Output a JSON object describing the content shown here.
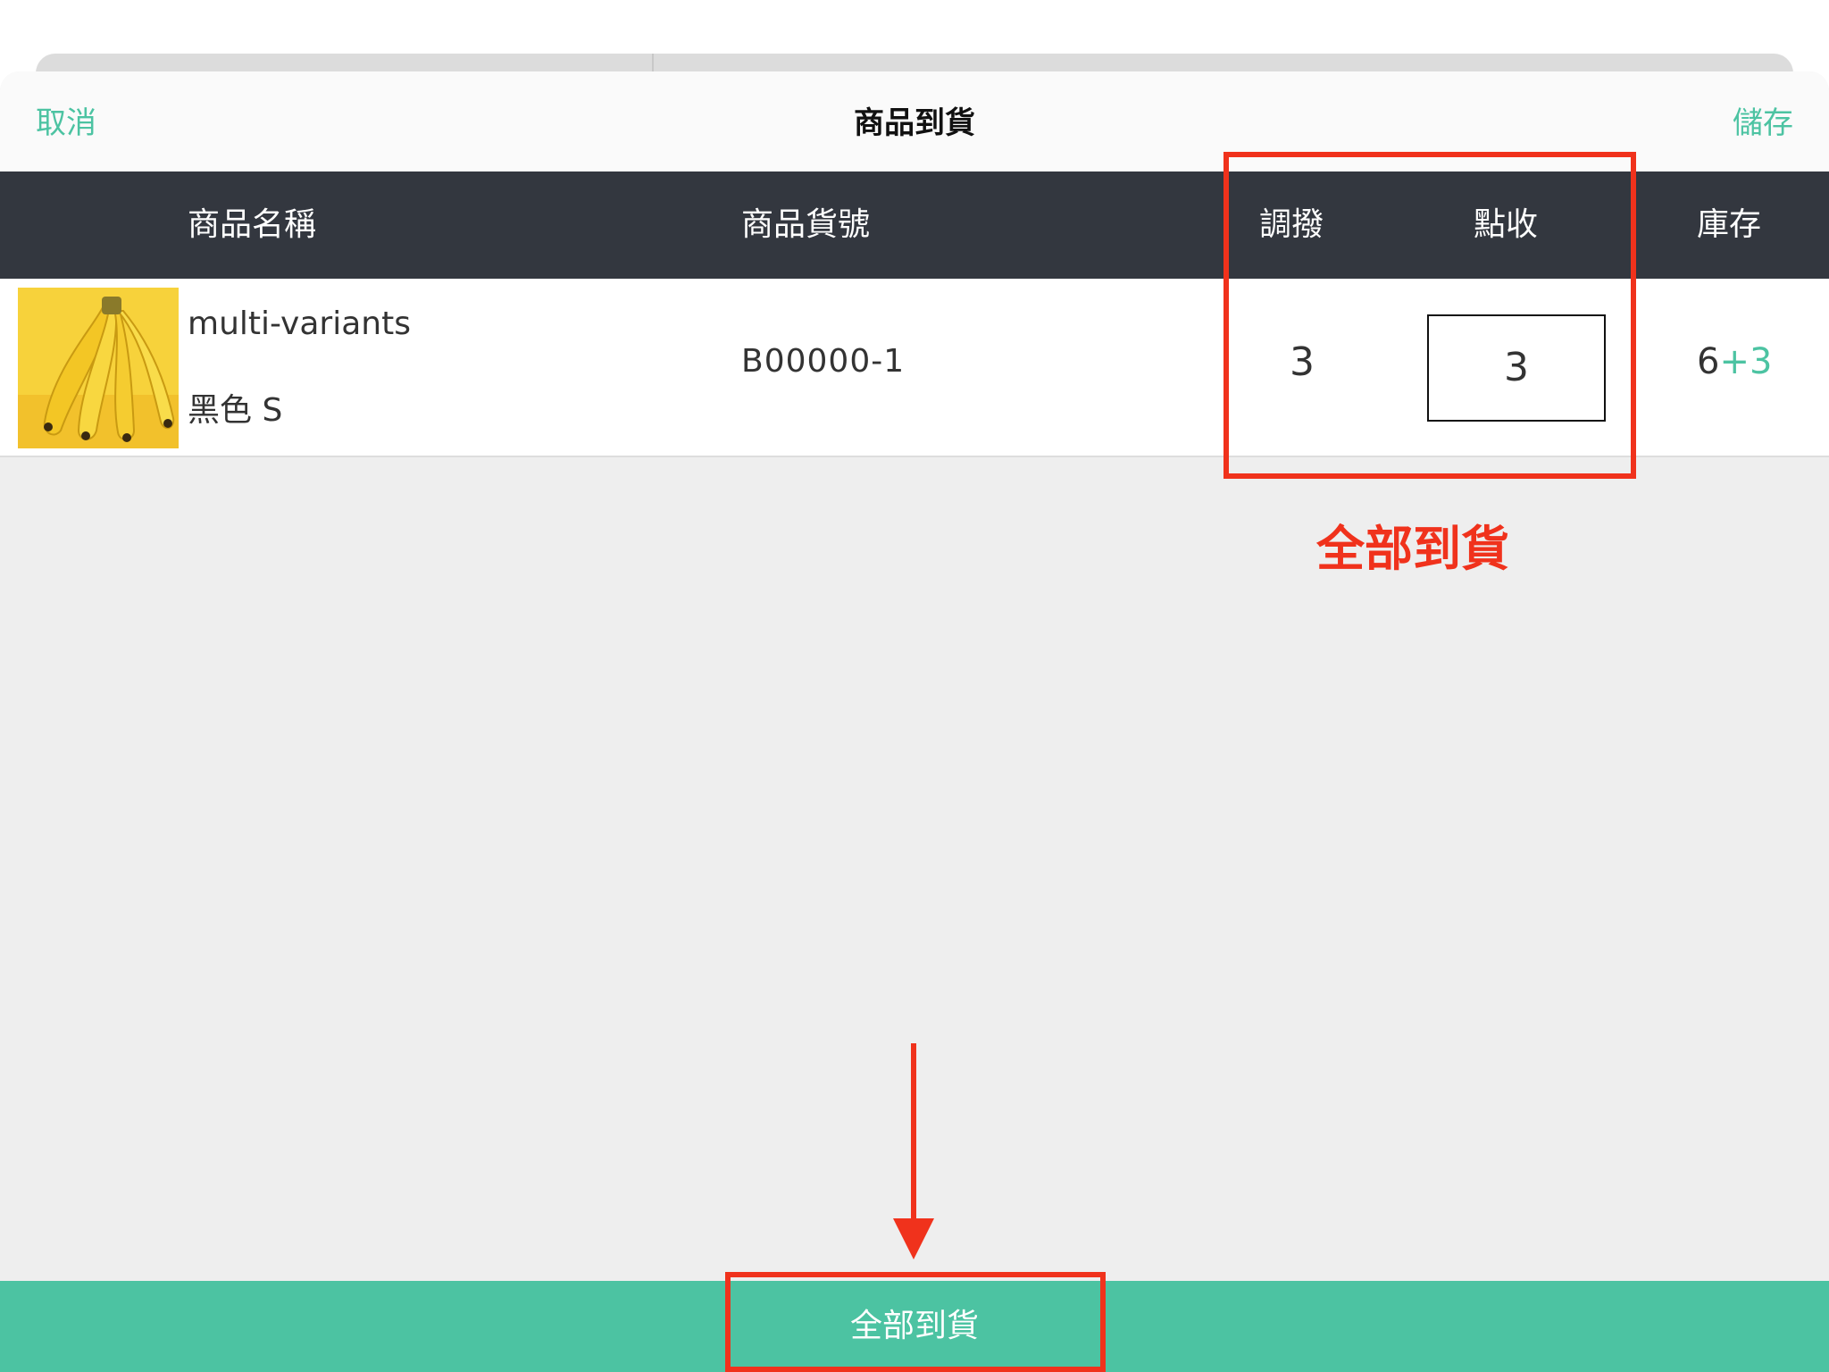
{
  "navbar": {
    "cancel_label": "取消",
    "title": "商品到貨",
    "save_label": "儲存"
  },
  "table": {
    "headers": {
      "name": "商品名稱",
      "sku": "商品貨號",
      "transfer": "調撥",
      "receive": "點收",
      "stock": "庫存"
    },
    "rows": [
      {
        "name": "multi-variants",
        "variant": "黑色 S",
        "sku": "B00000-1",
        "transfer": "3",
        "receive": "3",
        "stock_base": "6",
        "stock_delta": "+3"
      }
    ]
  },
  "action": {
    "receive_all_label": "全部到貨"
  },
  "annotation": {
    "label": "全部到貨"
  },
  "colors": {
    "accent": "#4cc3a2",
    "header_bg": "#33373f",
    "annotation": "#f0321c",
    "backdrop": "#eeeeee"
  },
  "icons": {
    "product_image": "banana-photo",
    "annotation_arrow": "arrow-down-icon"
  }
}
